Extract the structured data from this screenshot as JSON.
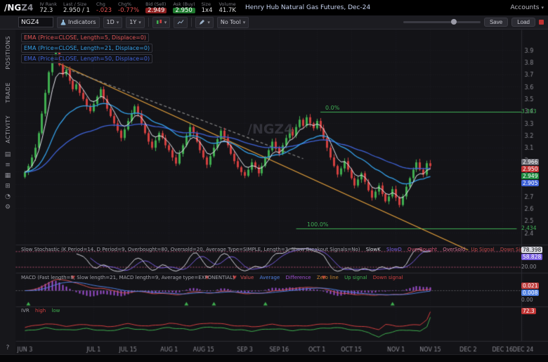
{
  "top_bar": {
    "symbol_root": "/NG",
    "symbol_suffix": "Z4",
    "fields": [
      {
        "label": "IV Rank",
        "value": "72.3"
      },
      {
        "label": "Last / Size",
        "value": "2.950 / 1"
      },
      {
        "label": "Chg",
        "value": "-.023"
      },
      {
        "label": "Chg%",
        "value": "-0.77%"
      },
      {
        "label": "Bid (Sell)",
        "value": "2.949"
      },
      {
        "label": "Ask (Buy)",
        "value": "2.950"
      },
      {
        "label": "Size",
        "value": "1x4"
      },
      {
        "label": "Volume",
        "value": "41.7K"
      }
    ],
    "description": "Henry Hub Natural Gas Futures, Dec-24",
    "accounts_label": "Accounts"
  },
  "icons": {
    "chevron_down": "▾"
  },
  "toolbar": {
    "symbol_input": "NGZ4",
    "indicators_label": "Indicators",
    "timeframe": "1D",
    "range": "1Y",
    "tool_label": "No Tool",
    "save_label": "Save",
    "load_label": "Load"
  },
  "sidebar": {
    "tabs": [
      "POSITIONS",
      "TRADE",
      "ACTIVITY"
    ],
    "icons": [
      {
        "name": "monitor-icon",
        "glyph": "▤"
      },
      {
        "name": "watchlist-icon",
        "glyph": "≡"
      },
      {
        "name": "chart-grid-icon",
        "glyph": "▦"
      },
      {
        "name": "calculator-icon",
        "glyph": "⊞"
      },
      {
        "name": "clock-icon",
        "glyph": "◔"
      },
      {
        "name": "gear-icon",
        "glyph": "⚙"
      }
    ],
    "help_glyph": "?"
  },
  "legend": {
    "emas": [
      {
        "text": "EMA (Price=CLOSE, Length=5, Displace=0)"
      },
      {
        "text": "EMA (Price=CLOSE, Length=21, Displace=0)"
      },
      {
        "text": "EMA (Price=CLOSE, Length=50, Displace=0)"
      }
    ]
  },
  "watermark": {
    "text": "/NGZ4"
  },
  "fib": {
    "upper": {
      "pct": "0.0%",
      "price_label": "3.393"
    },
    "lower": {
      "pct": "100.0%",
      "price_label": "2.434"
    }
  },
  "bubbles": {
    "price": [
      {
        "text": "2.966"
      },
      {
        "text": "2.950"
      },
      {
        "text": "2.949"
      },
      {
        "text": "2.905"
      }
    ],
    "stoch": [
      {
        "text": "78.398"
      },
      {
        "text": "58.828"
      }
    ],
    "stoch_axis": "20.00",
    "macd": [
      {
        "text": "0.021"
      },
      {
        "text": "0.008"
      }
    ],
    "macd_zero": "0.00",
    "ivr": [
      {
        "text": "72.3"
      }
    ]
  },
  "panels": {
    "stoch": {
      "title": "Slow Stochastic (K Period=14, D Period=9, Overbought=80, Oversold=20, Average Type=SIMPLE, Length=3, Show Breakout Signals=No)",
      "tokens": [
        "SlowK",
        "SlowD",
        "OverBought",
        "OverSold",
        "Up Signal",
        "Down Signal"
      ]
    },
    "macd": {
      "title": "MACD (Fast length=8, Slow length=21, MACD length=9, Average type=EXPONENTIAL)",
      "tokens": [
        "Value",
        "Average",
        "Difference",
        "Zero line",
        "Up signal",
        "Down signal"
      ]
    },
    "ivr": {
      "title": "IVR",
      "tokens": [
        "high",
        "low"
      ]
    }
  },
  "colors": {
    "up": "#3fae4f",
    "down": "#d23f3f",
    "ema5": "#e8e8f0",
    "ema21": "#35a0e8",
    "ema50": "#3f63d8",
    "trend": "#e8a33d",
    "trend_gray": "#8a8a8a",
    "fib": "#3fae55",
    "slowk": "#d8d8e0",
    "slowd": "#7a5fe0",
    "stoch_band": "#b05070",
    "macd_hist": "#9b4fd0",
    "macd_value": "#d05050",
    "macd_avg": "#4f7fe0",
    "ivr_high": "#d23f3f",
    "ivr_low": "#3fae4f",
    "grid": "#1e1e25",
    "separator": "#2b2b32",
    "axis_text": "#8a8a92",
    "bg": "#131317"
  },
  "chart_data": {
    "type": "candlestick",
    "symbol": "/NGZ4",
    "timeframe": "1Y 1D",
    "y_axis": {
      "min": 2.4,
      "max": 3.95,
      "tick_step": 0.1,
      "tick_min": 2.4,
      "tick_max": 3.9
    },
    "open_first": 2.86,
    "closes": [
      2.9,
      2.95,
      3.02,
      3.1,
      3.22,
      3.38,
      3.55,
      3.72,
      3.85,
      3.88,
      3.78,
      3.7,
      3.74,
      3.65,
      3.58,
      3.62,
      3.55,
      3.5,
      3.44,
      3.4,
      3.46,
      3.52,
      3.58,
      3.5,
      3.42,
      3.36,
      3.3,
      3.24,
      3.18,
      3.25,
      3.32,
      3.38,
      3.44,
      3.38,
      3.3,
      3.22,
      3.15,
      3.1,
      3.16,
      3.22,
      3.18,
      3.12,
      3.08,
      3.02,
      2.97,
      3.05,
      3.12,
      3.2,
      3.27,
      3.22,
      3.15,
      3.08,
      3.02,
      2.96,
      3.03,
      3.1,
      3.17,
      3.24,
      3.18,
      3.12,
      3.05,
      2.99,
      2.94,
      2.9,
      2.87,
      2.92,
      2.98,
      2.94,
      2.89,
      2.95,
      3.02,
      3.08,
      3.15,
      3.1,
      3.05,
      3.12,
      3.18,
      3.25,
      3.2,
      3.27,
      3.33,
      3.28,
      3.35,
      3.3,
      3.26,
      3.32,
      3.26,
      3.18,
      3.1,
      3.02,
      2.95,
      2.88,
      2.93,
      2.99,
      2.92,
      2.85,
      2.79,
      2.84,
      2.89,
      2.82,
      2.75,
      2.69,
      2.74,
      2.79,
      2.72,
      2.66,
      2.7,
      2.76,
      2.69,
      2.63,
      2.7,
      2.78,
      2.85,
      2.92,
      2.98,
      2.92,
      2.88,
      2.973,
      2.95
    ],
    "x_ticks": [
      {
        "label": "JUN 3",
        "i": 0
      },
      {
        "label": "JUL 1",
        "i": 20
      },
      {
        "label": "JUL 15",
        "i": 30
      },
      {
        "label": "AUG 1",
        "i": 42
      },
      {
        "label": "AUG 15",
        "i": 52
      },
      {
        "label": "SEP 3",
        "i": 64
      },
      {
        "label": "SEP 16",
        "i": 74
      },
      {
        "label": "OCT 1",
        "i": 85
      },
      {
        "label": "OCT 15",
        "i": 95
      },
      {
        "label": "NOV 1",
        "i": 108
      },
      {
        "label": "NOV 15",
        "i": 118
      },
      {
        "label": "DEC 2",
        "i": 129
      },
      {
        "label": "DEC 16",
        "i": 139
      },
      {
        "label": "DEC 24",
        "i": 145
      }
    ],
    "trendlines": [
      {
        "name": "downtrend-line",
        "color": "#e8a33d",
        "from": [
          10,
          3.79
        ],
        "to": [
          129,
          2.26
        ],
        "dash": false
      },
      {
        "name": "dashed-trendline",
        "color": "#8a8a8a",
        "from": [
          11,
          3.76
        ],
        "to": [
          81,
          3.01
        ],
        "dash": true
      }
    ],
    "fib_levels": [
      {
        "pct": "0.0%",
        "price": 3.393,
        "x_start_index": 86
      },
      {
        "pct": "100.0%",
        "price": 2.434,
        "x_start_index": 81
      }
    ],
    "emas": [
      {
        "length": 5
      },
      {
        "length": 21
      },
      {
        "length": 50
      }
    ],
    "stoch": {
      "overbought": 80,
      "oversold": 20
    },
    "ivr": {
      "high_anchors": [
        [
          0,
          42
        ],
        [
          6,
          55
        ],
        [
          12,
          47
        ],
        [
          18,
          52
        ],
        [
          24,
          44
        ],
        [
          30,
          54
        ],
        [
          36,
          46
        ],
        [
          42,
          56
        ],
        [
          48,
          48
        ],
        [
          54,
          58
        ],
        [
          60,
          50
        ],
        [
          66,
          44
        ],
        [
          72,
          52
        ],
        [
          78,
          46
        ],
        [
          84,
          50
        ],
        [
          90,
          56
        ],
        [
          96,
          48
        ],
        [
          100,
          42
        ],
        [
          103,
          36
        ],
        [
          105,
          52
        ],
        [
          108,
          46
        ],
        [
          112,
          50
        ],
        [
          115,
          50
        ],
        [
          117,
          70
        ],
        [
          118,
          96
        ]
      ],
      "low_anchors": [
        [
          0,
          30
        ],
        [
          6,
          40
        ],
        [
          12,
          33
        ],
        [
          18,
          38
        ],
        [
          24,
          30
        ],
        [
          30,
          40
        ],
        [
          36,
          32
        ],
        [
          42,
          42
        ],
        [
          48,
          34
        ],
        [
          54,
          44
        ],
        [
          60,
          36
        ],
        [
          66,
          30
        ],
        [
          72,
          38
        ],
        [
          78,
          32
        ],
        [
          84,
          36
        ],
        [
          90,
          42
        ],
        [
          96,
          34
        ],
        [
          100,
          26
        ],
        [
          103,
          8
        ],
        [
          105,
          22
        ],
        [
          108,
          30
        ],
        [
          112,
          34
        ],
        [
          115,
          28
        ],
        [
          117,
          45
        ],
        [
          118,
          78
        ]
      ]
    }
  }
}
